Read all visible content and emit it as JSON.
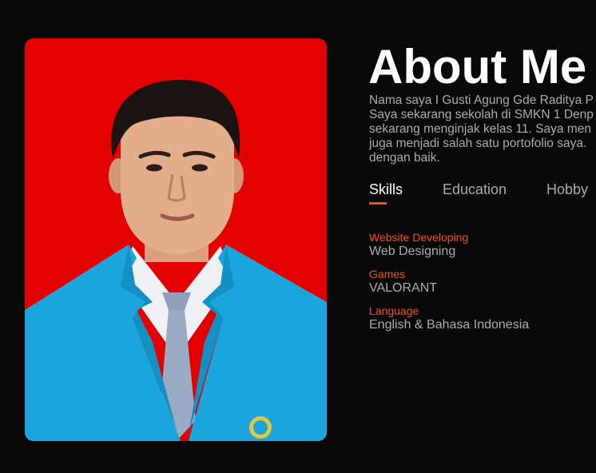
{
  "about": {
    "title": "About Me",
    "bio_lines": [
      "Nama saya I Gusti Agung Gde Raditya P",
      "Saya sekarang sekolah di SMKN 1 Denp",
      "sekarang menginjak kelas 11. Saya men",
      "juga menjadi salah satu portofolio saya.",
      "dengan baik."
    ]
  },
  "tabs": [
    {
      "label": "Skills",
      "active": true
    },
    {
      "label": "Education",
      "active": false
    },
    {
      "label": "Hobby",
      "active": false
    }
  ],
  "skills": [
    {
      "category": "Website Developing",
      "value": "Web Designing"
    },
    {
      "category": "Games",
      "value": "VALORANT"
    },
    {
      "category": "Language",
      "value": "English & Bahasa Indonesia"
    }
  ],
  "colors": {
    "background": "#080808",
    "accent": "#ff4d05",
    "heading": "#ffffff",
    "text": "#ababab",
    "photo_background": "#e30000",
    "blazer": "#1aa6dc"
  }
}
